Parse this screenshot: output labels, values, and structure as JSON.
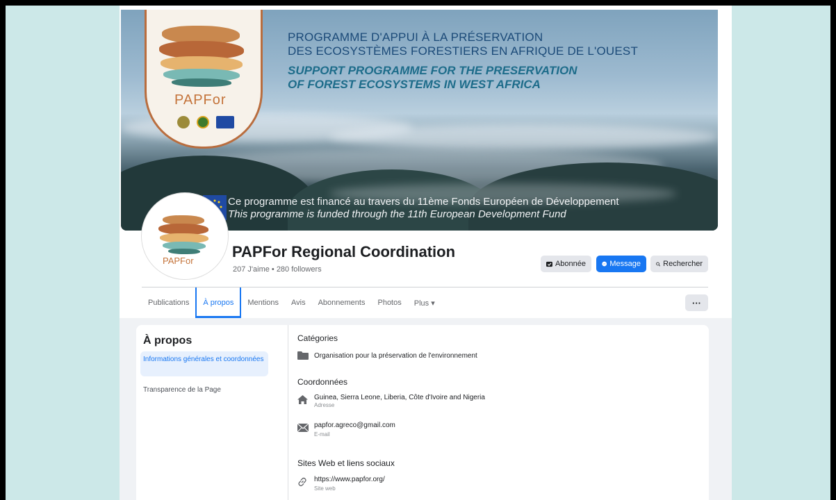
{
  "cover": {
    "title_fr_line1": "PROGRAMME D'APPUI À LA PRÉSERVATION",
    "title_fr_line2": "DES ECOSYSTÈMES FORESTIERS EN AFRIQUE DE L'OUEST",
    "title_en_line1": "SUPPORT PROGRAMME FOR THE PRESERVATION",
    "title_en_line2": "OF FOREST ECOSYSTEMS IN WEST AFRICA",
    "funded_fr": "Ce programme est financé au travers du 11ème Fonds Européen de Développement",
    "funded_en": "This programme is funded through the 11th European Development Fund",
    "logo_text": "PAPFor"
  },
  "profile": {
    "name": "PAPFor Regional Coordination",
    "stats": "207 J'aime • 280 followers",
    "logo_text": "PAPFor"
  },
  "actions": {
    "follow_label": "Abonnée",
    "message_label": "Message",
    "search_label": "Rechercher"
  },
  "tabs": [
    {
      "label": "Publications"
    },
    {
      "label": "À propos"
    },
    {
      "label": "Mentions"
    },
    {
      "label": "Avis"
    },
    {
      "label": "Abonnements"
    },
    {
      "label": "Photos"
    },
    {
      "label": "Plus ▾"
    }
  ],
  "more_button": "···",
  "about": {
    "title": "À propos",
    "sidebar": {
      "general": "Informations générales et coordonnées",
      "transparency": "Transparence de la Page"
    },
    "categories_title": "Catégories",
    "category": "Organisation pour la préservation de l'environnement",
    "contact_title": "Coordonnées",
    "address": "Guinea, Sierra Leone, Liberia, Côte d'Ivoire and Nigeria",
    "address_label": "Adresse",
    "email": "papfor.agreco@gmail.com",
    "email_label": "E-mail",
    "web_title": "Sites Web et liens sociaux",
    "website": "https://www.papfor.org/",
    "website_label": "Site web"
  },
  "colors": {
    "accent": "#1877f2",
    "frame_background": "#cce8e8"
  },
  "icons": [
    "folder-icon",
    "home-icon",
    "envelope-icon",
    "link-icon",
    "messenger-icon",
    "search-icon",
    "follow-icon",
    "chevron-down-icon",
    "more-icon"
  ]
}
